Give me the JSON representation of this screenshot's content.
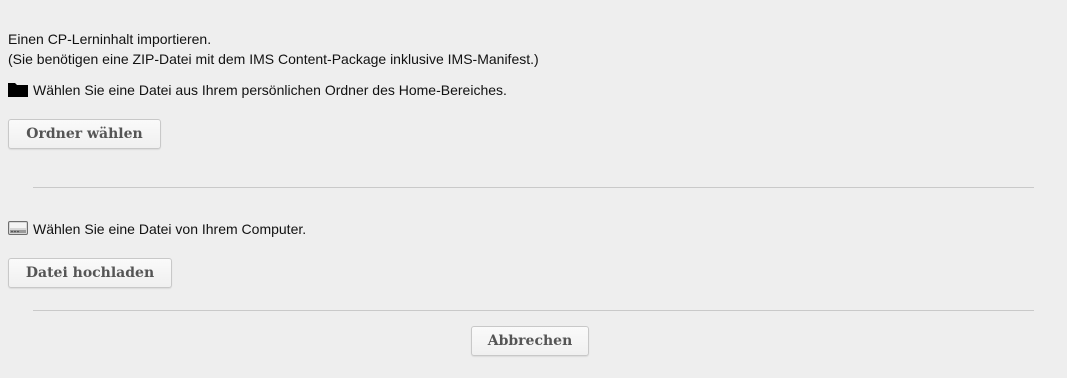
{
  "intro": {
    "line1": "Einen CP-Lerninhalt importieren.",
    "line2": "(Sie benötigen eine ZIP-Datei mit dem IMS Content-Package inklusive IMS-Manifest.)"
  },
  "folder_section": {
    "icon": "folder-icon",
    "text": "Wählen Sie eine Datei aus Ihrem persönlichen Ordner des Home-Bereiches.",
    "button_label": "Ordner wählen"
  },
  "computer_section": {
    "icon": "hard-drive-icon",
    "text": "Wählen Sie eine Datei von Ihrem Computer.",
    "button_label": "Datei hochladen"
  },
  "actions": {
    "cancel_label": "Abbrechen"
  },
  "colors": {
    "background": "#eeeeee",
    "button_text": "#555555",
    "divider": "#c9c9c9"
  }
}
